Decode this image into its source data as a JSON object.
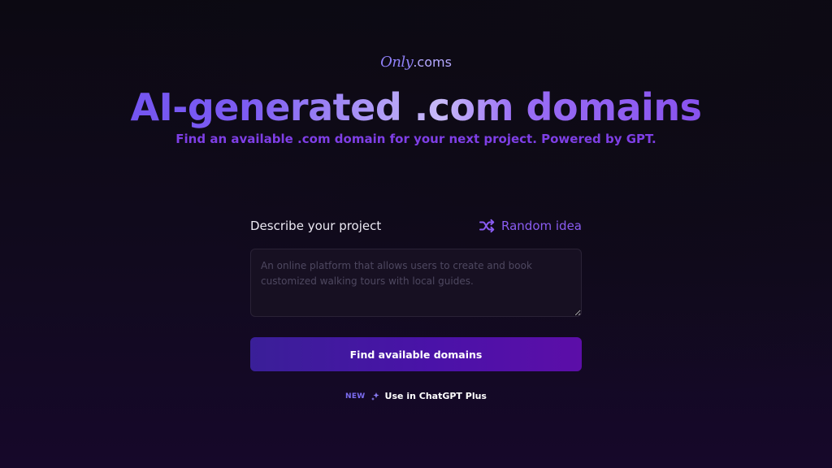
{
  "logo": {
    "script": "Only",
    "tld": ".coms"
  },
  "hero": {
    "headline": "AI-generated .com domains",
    "subheadline": "Find an available .com domain for your next project. Powered by GPT."
  },
  "form": {
    "label": "Describe your project",
    "random_label": "Random idea",
    "placeholder": "An online platform that allows users to create and book customized walking tours with local guides.",
    "value": "",
    "submit_label": "Find available domains"
  },
  "promo": {
    "badge": "NEW",
    "link_label": "Use in ChatGPT Plus"
  },
  "colors": {
    "accent": "#7f3fe6",
    "button": "#4a12a8",
    "background": "#0c0912"
  },
  "icons": {
    "random": "shuffle-icon",
    "promo": "sparkle-icon"
  }
}
